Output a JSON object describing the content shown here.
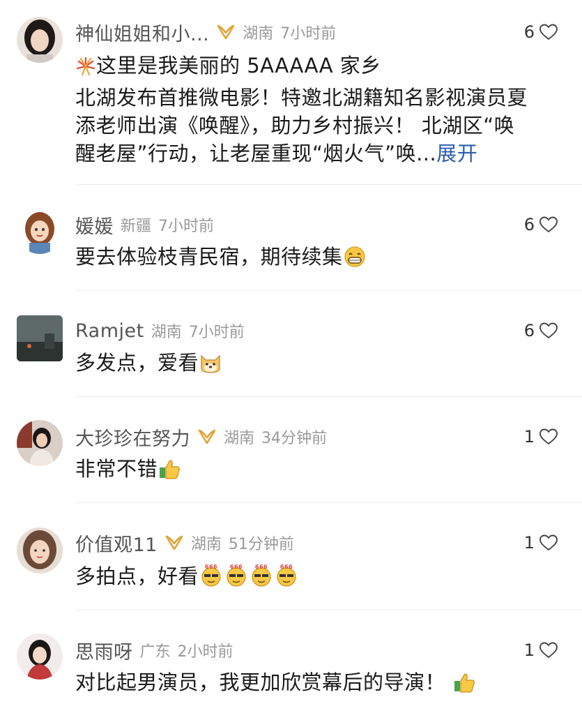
{
  "comments": [
    {
      "name": "神仙姐姐和小...",
      "location": "湖南",
      "time": "7小时前",
      "likes": "6",
      "line1": "这里是我美丽的 5AAAAA 家乡",
      "line2": "北湖发布首推微电影！特邀北湖籍知名影视演员夏",
      "line3": "添老师出演《唤醒》，助力乡村振兴！ 北湖区“唤",
      "line4": "醒老屋”行动，让老屋重现“烟火气”唤...",
      "expand": "展开",
      "has_badge": true
    },
    {
      "name": "媛媛",
      "location": "新疆",
      "time": "7小时前",
      "likes": "6",
      "text": "要去体验枝青民宿，期待续集",
      "has_badge": false
    },
    {
      "name": "Ramjet",
      "location": "湖南",
      "time": "7小时前",
      "likes": "6",
      "text": "多发点，爱看",
      "has_badge": false
    },
    {
      "name": "大珍珍在努力",
      "location": "湖南",
      "time": "34分钟前",
      "likes": "1",
      "text": "非常不错",
      "has_badge": true
    },
    {
      "name": "价值观11",
      "location": "湖南",
      "time": "51分钟前",
      "likes": "1",
      "text": "多拍点，好看",
      "emoji_label": "666",
      "has_badge": true
    },
    {
      "name": "思雨呀",
      "location": "广东",
      "time": "2小时前",
      "likes": "1",
      "text": "对比起男演员，我更加欣赏幕后的导演！",
      "has_badge": false
    }
  ],
  "icons": {
    "like": "heart-outline-icon",
    "badge": "gold-membership-badge-icon"
  },
  "colors": {
    "name": "#555555",
    "meta": "#999999",
    "text": "#1a1a1a",
    "link": "#2a5db0",
    "badge": "#e0a43a"
  }
}
